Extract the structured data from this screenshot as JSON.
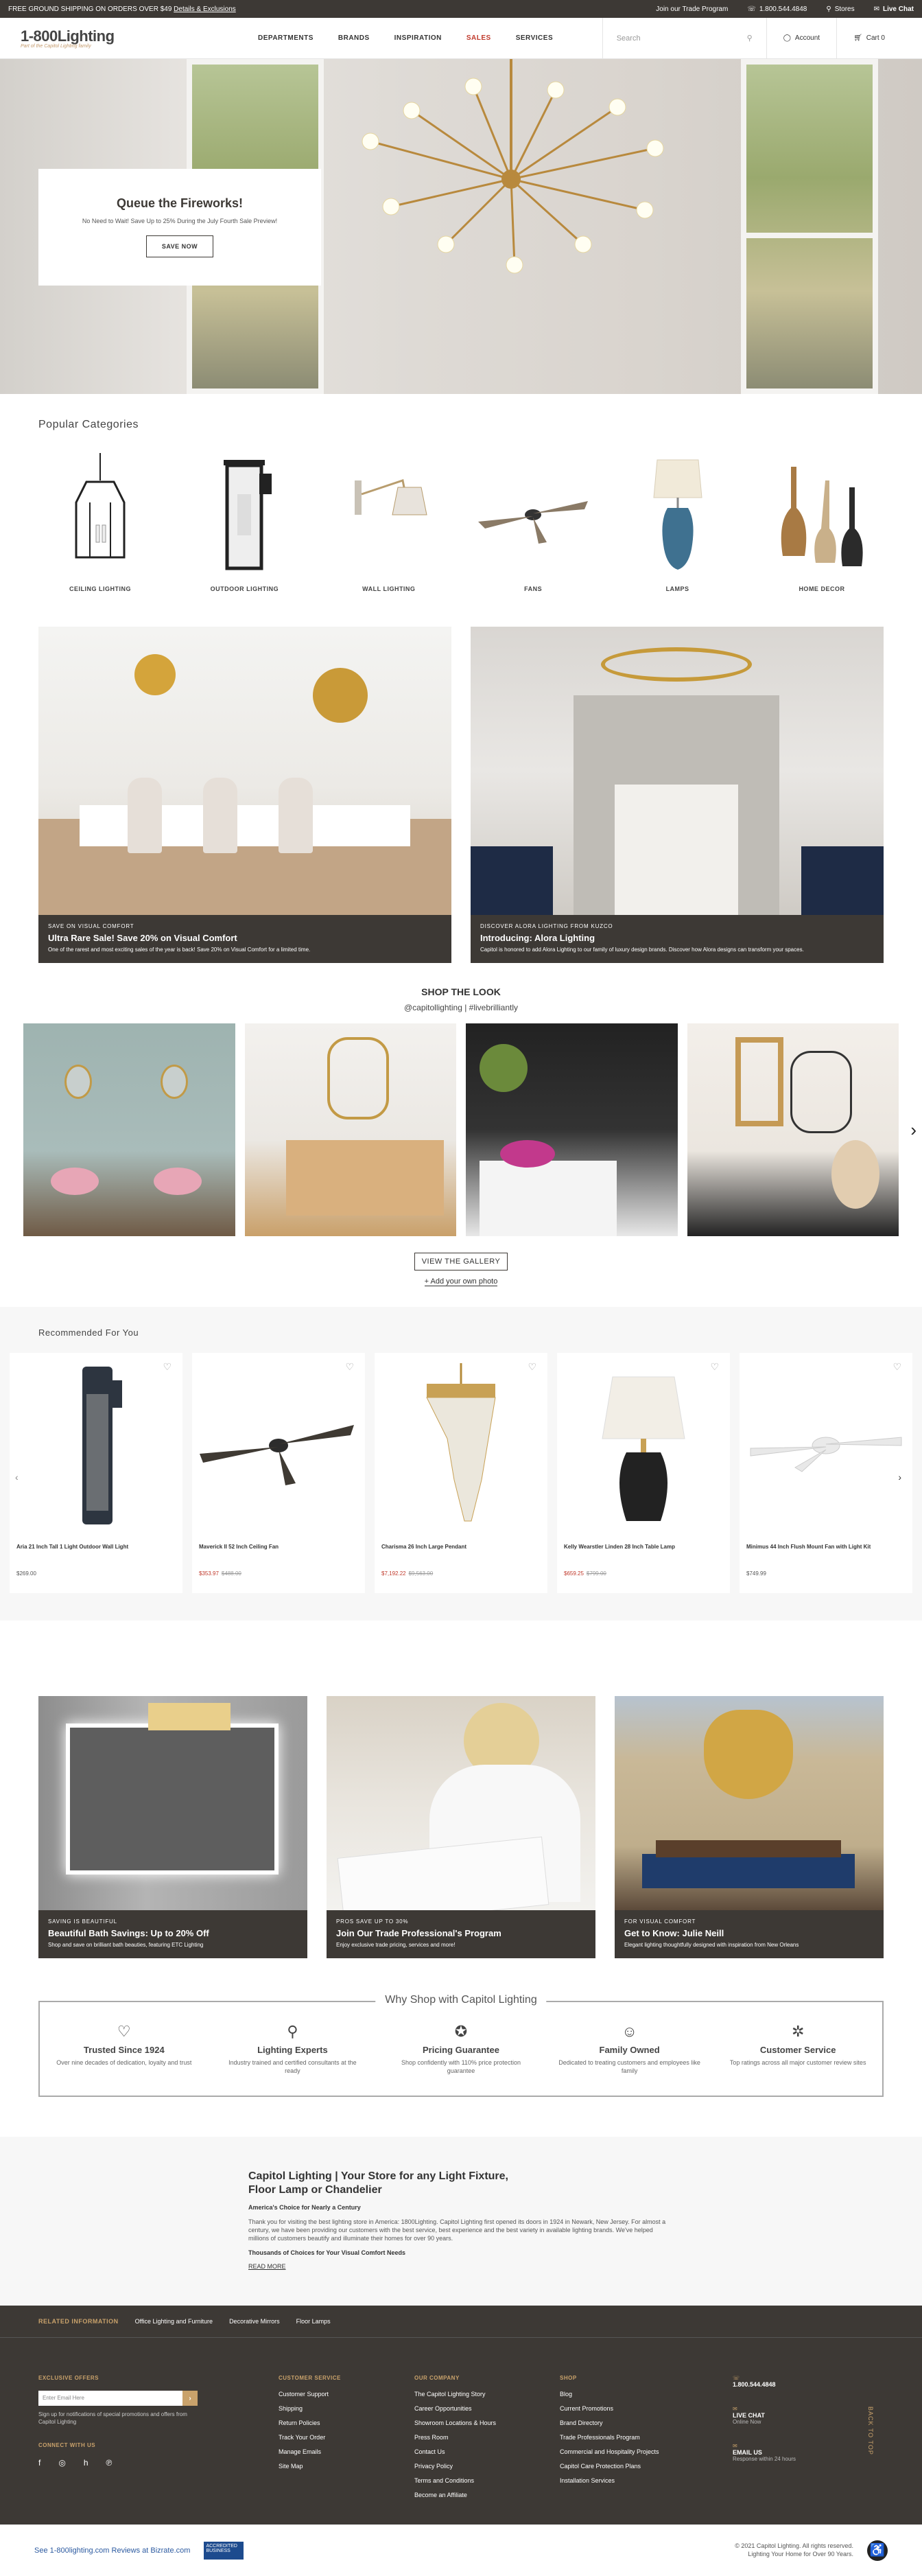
{
  "topbar": {
    "promo": "FREE GROUND SHIPPING ON ORDERS OVER $49",
    "details_link": "Details & Exclusions",
    "trade": "Join our Trade Program",
    "phone": "1.800.544.4848",
    "stores": "Stores",
    "chat": "Live Chat"
  },
  "header": {
    "logo": "1-800Lighting",
    "logo_tag": "Part of the Capitol Lighting family",
    "nav": [
      "DEPARTMENTS",
      "BRANDS",
      "INSPIRATION",
      "SALES",
      "SERVICES"
    ],
    "search_placeholder": "Search",
    "account": "Account",
    "cart": "Cart 0"
  },
  "hero": {
    "title": "Queue the Fireworks!",
    "subtitle": "No Need to Wait! Save Up to 25% During the July Fourth Sale Preview!",
    "button": "SAVE NOW"
  },
  "categories": {
    "title": "Popular Categories",
    "items": [
      "CEILING LIGHTING",
      "OUTDOOR LIGHTING",
      "WALL LIGHTING",
      "FANS",
      "LAMPS",
      "HOME DECOR"
    ]
  },
  "promos": [
    {
      "kicker": "SAVE ON VISUAL COMFORT",
      "title": "Ultra Rare Sale! Save 20% on Visual Comfort",
      "desc": "One of the rarest and most exciting sales of the year is back! Save 20% on Visual Comfort for a limited time."
    },
    {
      "kicker": "DISCOVER ALORA LIGHTING FROM KUZCO",
      "title": "Introducing: Alora Lighting",
      "desc": "Capitol is honored to add Alora Lighting to our family of luxury design brands. Discover how Alora designs can transform your spaces."
    }
  ],
  "look": {
    "title": "SHOP THE LOOK",
    "handle": "@capitollighting | #livebrilliantly",
    "gallery_button": "VIEW THE GALLERY",
    "add_photo": "+ Add your own photo"
  },
  "recommended": {
    "title": "Recommended For You",
    "products": [
      {
        "name": "Aria 21 Inch Tall 1 Light Outdoor Wall Light",
        "price": "$269.00",
        "sale": "",
        "orig": ""
      },
      {
        "name": "Maverick II 52 Inch Ceiling Fan",
        "price": "",
        "sale": "$353.97",
        "orig": "$488.00"
      },
      {
        "name": "Charisma 26 Inch Large Pendant",
        "price": "",
        "sale": "$7,192.22",
        "orig": "$9,563.00"
      },
      {
        "name": "Kelly Wearstler Linden 28 Inch Table Lamp",
        "price": "",
        "sale": "$659.25",
        "orig": "$799.00"
      },
      {
        "name": "Minimus 44 Inch Flush Mount Fan with Light Kit",
        "price": "$749.99",
        "sale": "",
        "orig": ""
      }
    ]
  },
  "trio": [
    {
      "kicker": "SAVING IS BEAUTIFUL",
      "title": "Beautiful Bath Savings: Up to 20% Off",
      "desc": "Shop and save on brilliant bath beauties, featuring ETC Lighting"
    },
    {
      "kicker": "PROS SAVE UP TO 30%",
      "title": "Join Our Trade Professional's Program",
      "desc": "Enjoy exclusive trade pricing, services and more!"
    },
    {
      "kicker": "FOR VISUAL COMFORT",
      "title": "Get to Know: Julie Neill",
      "desc": "Elegant lighting thoughtfully designed with inspiration from New Orleans"
    }
  ],
  "why": {
    "title": "Why Shop with Capitol Lighting",
    "items": [
      {
        "icon": "heart-hand-icon",
        "glyph": "♡",
        "title": "Trusted Since 1924",
        "desc": "Over nine decades of dedication, loyalty and trust"
      },
      {
        "icon": "pin-icon",
        "glyph": "⚲",
        "title": "Lighting Experts",
        "desc": "Industry trained and certified consultants at the ready"
      },
      {
        "icon": "badge-icon",
        "glyph": "✪",
        "title": "Pricing Guarantee",
        "desc": "Shop confidently with 110% price protection guarantee"
      },
      {
        "icon": "family-icon",
        "glyph": "☺",
        "title": "Family Owned",
        "desc": "Dedicated to treating customers and employees like family"
      },
      {
        "icon": "star-cluster-icon",
        "glyph": "✲",
        "title": "Customer Service",
        "desc": "Top ratings across all major customer review sites"
      }
    ]
  },
  "about": {
    "title": "Capitol Lighting | Your Store for any Light Fixture, Floor Lamp or Chandelier",
    "sub": "America's Choice for Nearly a Century",
    "body": "Thank you for visiting the best lighting store in America: 1800Lighting. Capitol Lighting first opened its doors in 1924 in Newark, New Jersey. For almost a century, we have been providing our customers with the best service, best experience and the best variety in available lighting brands. We've helped millions of customers beautify and illuminate their homes for over 90 years.",
    "sub2": "Thousands of Choices for Your Visual Comfort Needs",
    "more": "READ MORE"
  },
  "footer": {
    "related_label": "RELATED INFORMATION",
    "related": [
      "Office Lighting and Furniture",
      "Decorative Mirrors",
      "Floor Lamps"
    ],
    "offers_label": "EXCLUSIVE OFFERS",
    "email_placeholder": "Enter Email Here",
    "signup_note": "Sign up for notifications of special promotions and offers from Capitol Lighting",
    "connect_label": "CONNECT WITH US",
    "cols": [
      {
        "label": "CUSTOMER SERVICE",
        "items": [
          "Customer Support",
          "Shipping",
          "Return Policies",
          "Track Your Order",
          "Manage Emails",
          "Site Map"
        ]
      },
      {
        "label": "OUR COMPANY",
        "items": [
          "The Capitol Lighting Story",
          "Career Opportunities",
          "Showroom Locations & Hours",
          "Press Room",
          "Contact Us",
          "Privacy Policy",
          "Terms and Conditions",
          "Become an Affiliate"
        ]
      },
      {
        "label": "SHOP",
        "items": [
          "Blog",
          "Current Promotions",
          "Brand Directory",
          "Trade Professionals Program",
          "Commercial and Hospitality Projects",
          "Capitol Care Protection Plans",
          "Installation Services"
        ]
      }
    ],
    "contact": [
      {
        "t": "1.800.544.4848",
        "s": ""
      },
      {
        "t": "LIVE CHAT",
        "s": "Online Now"
      },
      {
        "t": "EMAIL US",
        "s": "Response within 24 hours"
      }
    ],
    "back_to_top": "BACK TO TOP",
    "reviews": "See 1-800lighting.com Reviews at Bizrate.com",
    "bbb": "ACCREDITED BUSINESS",
    "copyright": "© 2021 Capitol Lighting. All rights reserved.",
    "copyright2": "Lighting Your Home for Over 90 Years."
  }
}
